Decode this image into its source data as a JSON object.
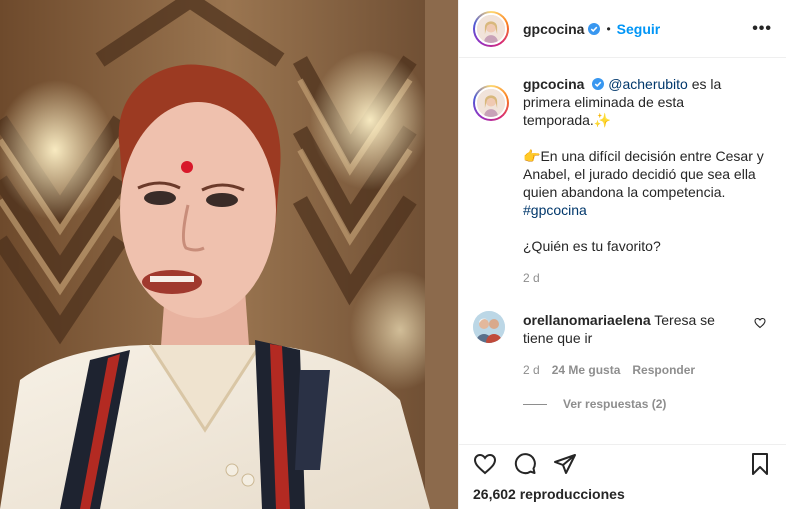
{
  "post": {
    "username": "gpcocina",
    "follow_label": "Seguir",
    "separator": "•",
    "more_label": "•••"
  },
  "caption": {
    "username": "gpcocina",
    "mention": "@acherubito",
    "line1_rest": " es la primera eliminada de esta temporada.",
    "sparkle": "✨",
    "pointer": "👉",
    "line2": "En una difícil decisión entre Cesar y Anabel, el jurado decidió que sea ella quien abandona la competencia.",
    "hashtag": "#gpcocina",
    "question": "¿Quién es tu favorito?",
    "time": "2 d"
  },
  "comment": {
    "username": "orellanomariaelena",
    "text": "Teresa se tiene que ir",
    "time": "2 d",
    "likes": "24 Me gusta",
    "reply_label": "Responder",
    "view_replies": "Ver respuestas (2)"
  },
  "footer": {
    "views": "26,602 reproducciones"
  },
  "icons": {
    "verified": "verified-badge-icon",
    "like": "heart-icon",
    "comment": "comment-icon",
    "share": "paper-plane-icon",
    "save": "bookmark-icon"
  },
  "colors": {
    "accent": "#0095f6",
    "link": "#00376b",
    "muted": "#8e8e8e"
  }
}
